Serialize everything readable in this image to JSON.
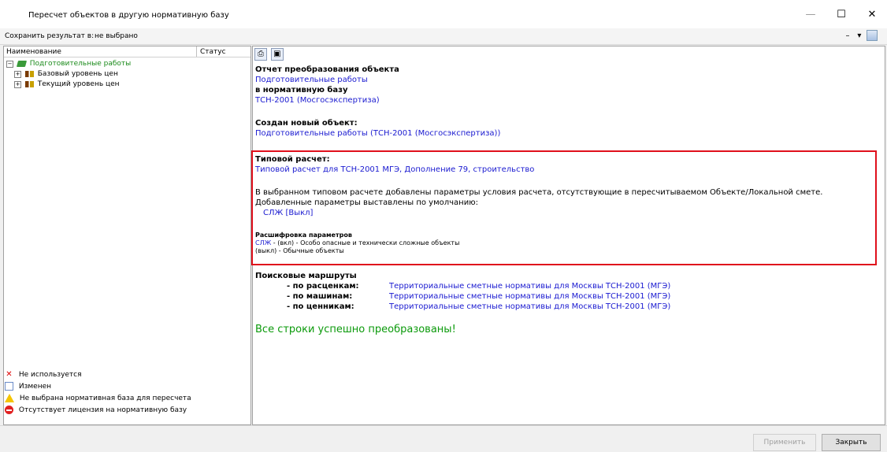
{
  "window": {
    "title": "Пересчет объектов в другую нормативную базу",
    "minimize_glyph": "—",
    "maximize_glyph": "☐",
    "close_glyph": "✕"
  },
  "savebar": {
    "label": "Сохранить результат в:",
    "value": "не выбрано",
    "tool_minus": "–",
    "tool_dropdown": "▾"
  },
  "tree": {
    "col_name": "Наименование",
    "col_status": "Статус",
    "items": [
      {
        "label": "Подготовительные работы",
        "expander": "−",
        "icon": "book-icon"
      },
      {
        "label": "Базовый уровень цен",
        "expander": "+",
        "icon": "level-icon"
      },
      {
        "label": "Текущий уровень цен",
        "expander": "+",
        "icon": "level-icon"
      }
    ]
  },
  "legend": [
    {
      "label": "Не используется",
      "icon": "cross-icon"
    },
    {
      "label": "Изменен",
      "icon": "edit-icon"
    },
    {
      "label": "Не выбрана нормативная база для пересчета",
      "icon": "warning-icon"
    },
    {
      "label": "Отсутствует лицензия на нормативную базу",
      "icon": "no-entry-icon"
    }
  ],
  "report": {
    "h1": "Отчет преобразования объекта",
    "object_name": "Подготовительные работы",
    "to_base_label": "в нормативную базу",
    "base_name": "ТСН-2001 (Мосгосэкспертиза)",
    "created_label": "Создан новый объект:",
    "created_name": "Подготовительные работы (ТСН-2001 (Мосгосэкспертиза))",
    "typical_label": "Типовой расчет:",
    "typical_name": "Типовой расчет для ТСН-2001 МГЭ, Дополнение 79, строительство",
    "typical_note1": "В выбранном типовом расчете добавлены параметры условия расчета, отсутствующие в пересчитываемом Объекте/Локальной смете.",
    "typical_note2": "Добавленные параметры выставлены по умолчанию:",
    "param_default": "СЛЖ [Выкл]",
    "decode_label": "Расшифровка параметров",
    "decode_code": "СЛЖ",
    "decode_line1_rest": " - (вкл) - Особо опасные и технически сложные объекты",
    "decode_line2": "(выкл) - Обычные объекты",
    "routes_label": "Поисковые маршруты",
    "routes": [
      {
        "label": "- по расценкам:",
        "value": "Территориальные сметные нормативы для Москвы ТСН-2001 (МГЭ)"
      },
      {
        "label": "- по машинам:",
        "value": "Территориальные сметные нормативы для Москвы ТСН-2001 (МГЭ)"
      },
      {
        "label": "- по ценникам:",
        "value": "Территориальные сметные нормативы для Москвы ТСН-2001 (МГЭ)"
      }
    ],
    "success": "Все строки успешно преобразованы!"
  },
  "buttons": {
    "apply": "Применить",
    "close": "Закрыть"
  },
  "colors": {
    "link": "#1a1ad0",
    "success": "#0b9a0b",
    "highlight": "#e0101c"
  }
}
